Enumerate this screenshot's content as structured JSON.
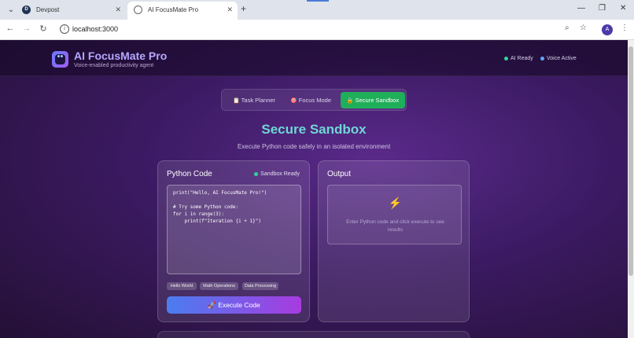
{
  "browser": {
    "tabs": [
      {
        "label": "Devpost",
        "icon": "devpost-favicon"
      },
      {
        "label": "AI FocusMate Pro",
        "icon": "globe-icon"
      }
    ],
    "url": "localhost:3000",
    "avatar_letter": "A"
  },
  "header": {
    "title": "AI FocusMate Pro",
    "subtitle": "Voice-enabled productivity agent",
    "status": [
      {
        "label": "AI Ready",
        "color": "#34d399"
      },
      {
        "label": "Voice Active",
        "color": "#60a5fa"
      }
    ]
  },
  "nav": {
    "tabs": [
      {
        "label": "Task Planner",
        "icon": "📋"
      },
      {
        "label": "Focus Mode",
        "icon": "🎯"
      },
      {
        "label": "Secure Sandbox",
        "icon": "🔒"
      }
    ],
    "active": "Secure Sandbox",
    "active_color": "#1fae5a"
  },
  "section": {
    "title": "Secure Sandbox",
    "subtitle": "Execute Python code safely in an isolated environment"
  },
  "code_panel": {
    "title": "Python Code",
    "status": "Sandbox Ready",
    "code_lines": [
      "print(\"Hello, AI FocusMate Pro!\")",
      "",
      "# Try some Python code:",
      "for i in range(3):",
      "    print(f\"Iteration {i + 1}\")"
    ],
    "samples": [
      "Hello World",
      "Math Operations",
      "Data Processing"
    ],
    "execute_label": "Execute Code",
    "execute_icon": "🚀"
  },
  "output_panel": {
    "title": "Output",
    "icon": "⚡",
    "hint": "Enter Python code and click execute to see results"
  }
}
